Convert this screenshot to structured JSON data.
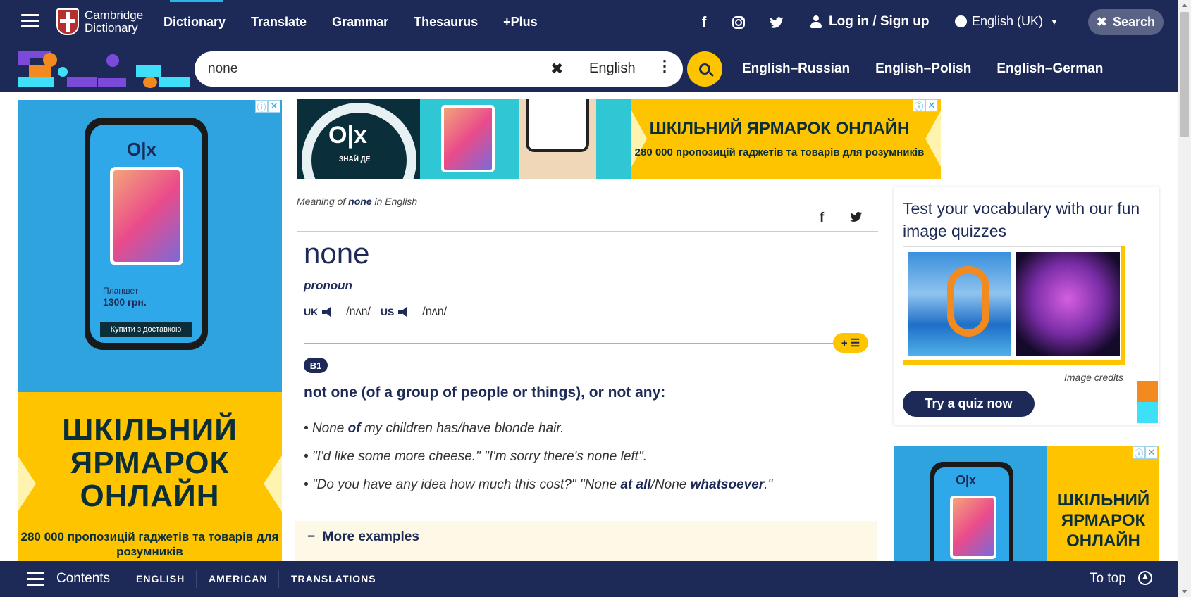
{
  "header": {
    "logo_line1": "Cambridge",
    "logo_line2": "Dictionary",
    "nav": [
      "Dictionary",
      "Translate",
      "Grammar",
      "Thesaurus",
      "+Plus"
    ],
    "login": "Log in / Sign up",
    "language": "English (UK)",
    "search_button": "Search",
    "social_icons": [
      "facebook-icon",
      "instagram-icon",
      "twitter-icon"
    ]
  },
  "search": {
    "query": "none",
    "dictionary": "English",
    "quick_links": [
      "English–Russian",
      "English–Polish",
      "English–German"
    ]
  },
  "entry": {
    "meaning_prefix": "Meaning of",
    "meaning_word": "none",
    "meaning_suffix": "in English",
    "headword": "none",
    "pos": "pronoun",
    "uk_label": "UK",
    "uk_ipa": "/nʌn/",
    "us_label": "US",
    "us_ipa": "/nʌn/",
    "level": "B1",
    "definition": "not one (of a group of people or things), or not any:",
    "examples": [
      {
        "a": "None ",
        "b": "of",
        "c": " my children has/have blonde hair."
      },
      {
        "a": "\"I'd like some more cheese.\" \"I'm sorry there's none left\".",
        "b": "",
        "c": ""
      },
      {
        "a": "\"Do you have any idea how much this cost?\" \"None ",
        "b": "at all",
        "c": "/None ",
        "d": "whatsoever",
        "e": ".\""
      }
    ],
    "more_examples": "More examples"
  },
  "quiz": {
    "title": "Test your vocabulary with our fun image quizzes",
    "credits": "Image credits",
    "button": "Try a quiz now"
  },
  "ads": {
    "left_big": "ШКІЛЬНИЙ ЯРМАРОК ОНЛАЙН",
    "left_small": "280 000 пропозицій гаджетів та товарів для розумників",
    "top_big": "ШКІЛЬНИЙ ЯРМАРОК ОНЛАЙН",
    "top_small": "280 000 пропозицій гаджетів та товарів для розумників",
    "right_big": "ШКІЛЬНИЙ ЯРМАРОК ОНЛАЙН",
    "olx": "O|x",
    "olx_tag": "ЗНАЙ ДЕ",
    "phone_price_label": "Планшет",
    "phone_price": "1300 грн.",
    "phone_buy": "Купити з доставкою"
  },
  "bottom": {
    "contents": "Contents",
    "tabs": [
      "ENGLISH",
      "AMERICAN",
      "TRANSLATIONS"
    ],
    "to_top": "To top"
  },
  "colors": {
    "navy": "#1d2a57",
    "yellow": "#fec400",
    "cyan": "#29b6e6"
  }
}
